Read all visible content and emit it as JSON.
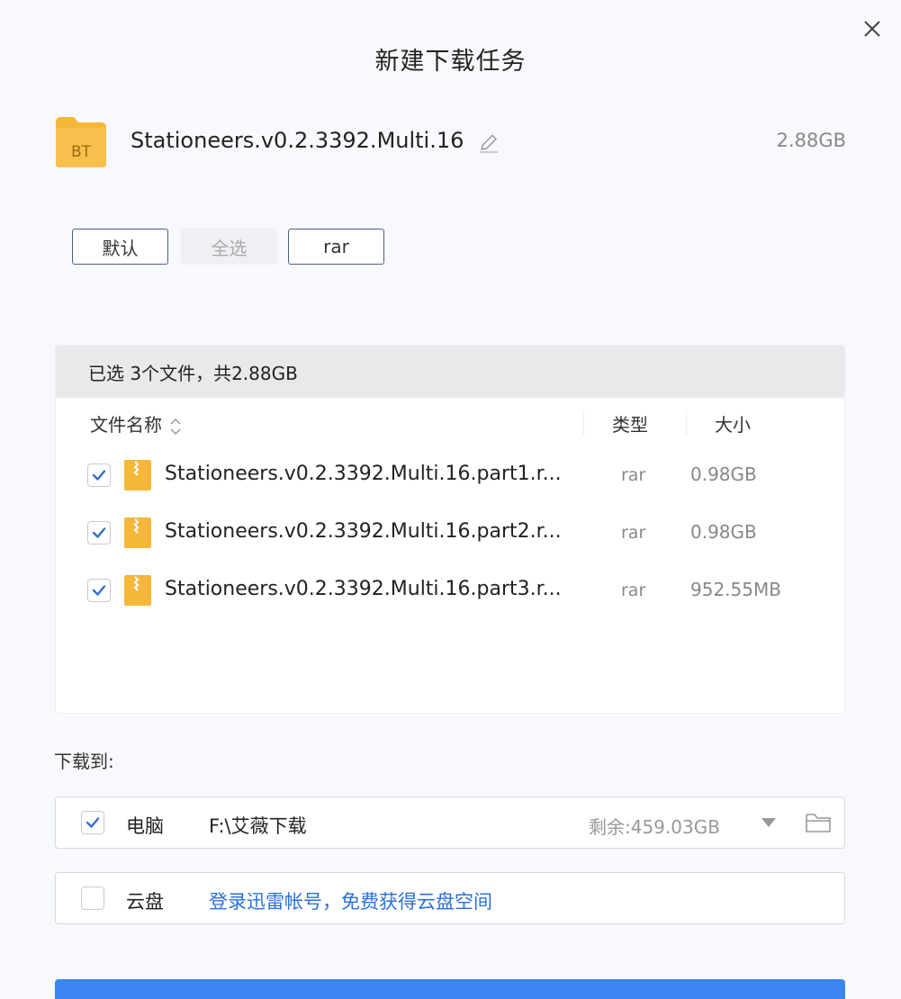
{
  "dialog": {
    "title": "新建下载任务"
  },
  "torrent": {
    "icon": "bt-file-icon",
    "icon_text": "BT",
    "name": "Stationeers.v0.2.3392.Multi.16",
    "size": "2.88GB"
  },
  "filters": [
    {
      "label": "默认",
      "style": "outlined"
    },
    {
      "label": "全选",
      "style": "flat"
    },
    {
      "label": "rar",
      "style": "outlined"
    }
  ],
  "file_list": {
    "summary": "已选 3个文件，共2.88GB",
    "columns": {
      "name": "文件名称",
      "type": "类型",
      "size": "大小"
    },
    "files": [
      {
        "name": "Stationeers.v0.2.3392.Multi.16.part1.r...",
        "type": "rar",
        "size": "0.98GB",
        "checked": true
      },
      {
        "name": "Stationeers.v0.2.3392.Multi.16.part2.r...",
        "type": "rar",
        "size": "0.98GB",
        "checked": true
      },
      {
        "name": "Stationeers.v0.2.3392.Multi.16.part3.r...",
        "type": "rar",
        "size": "952.55MB",
        "checked": true
      }
    ]
  },
  "destination": {
    "label": "下载到:",
    "local": {
      "label": "电脑",
      "path": "F:\\艾薇下载",
      "free": "剩余:459.03GB",
      "checked": true
    },
    "cloud": {
      "label": "云盘",
      "link": "登录迅雷帐号，免费获得云盘空间",
      "checked": false
    }
  },
  "colors": {
    "accent": "#3b86f0",
    "link": "#2b6fd6",
    "folder": "#f5b73a",
    "check": "#2f6fd0"
  }
}
